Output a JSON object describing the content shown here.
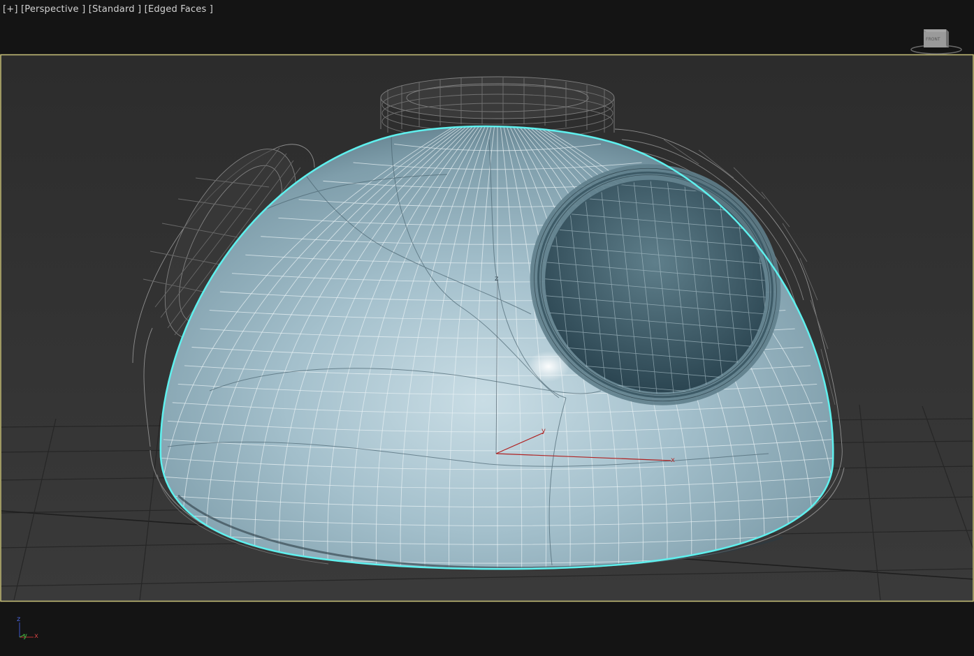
{
  "viewport": {
    "label_plus": "[+]",
    "label_view": "[Perspective ]",
    "label_shading": "[Standard ]",
    "label_display": "[Edged Faces ]"
  },
  "viewcube": {
    "face_label": "FRONT"
  },
  "gizmo": {
    "x_label": "x",
    "y_label": "y",
    "z_label": "z"
  },
  "world_axis": {
    "x_label": "x",
    "y_label": "y",
    "z_label": "z"
  },
  "colors": {
    "active_border": "#c9c27a",
    "selection_outline": "#5ff0ee",
    "mesh_fill": "#9fbcc8",
    "grid": "#2e2e2e"
  }
}
